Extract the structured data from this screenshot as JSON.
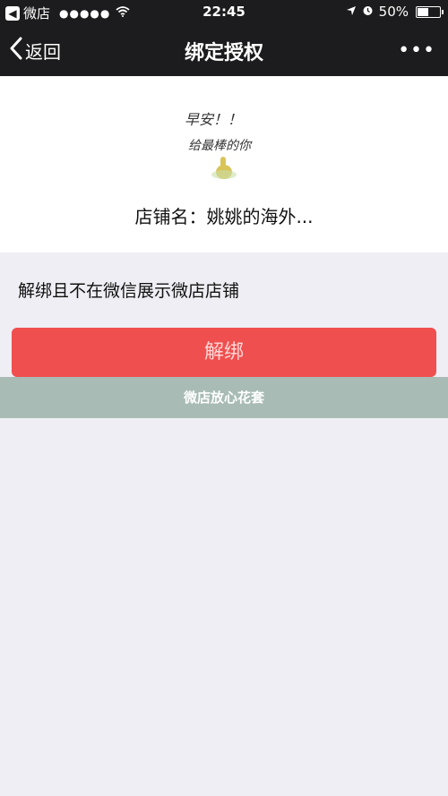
{
  "status_bar": {
    "carrier": "微店",
    "signal": "●●●●●",
    "time": "22:45",
    "battery_percent_label": "50%",
    "battery_level": 0.5
  },
  "nav": {
    "back_label": "返回",
    "title": "绑定授权",
    "more_label": "•••"
  },
  "shop": {
    "image_text_line1": "早安！！",
    "image_text_line2": "给最棒的你",
    "name": "店铺名：姚姚的海外..."
  },
  "main": {
    "description": "解绑且不在微信展示微店店铺",
    "unbind_button": "解绑"
  },
  "watermark": {
    "text": "微店放心花套"
  }
}
